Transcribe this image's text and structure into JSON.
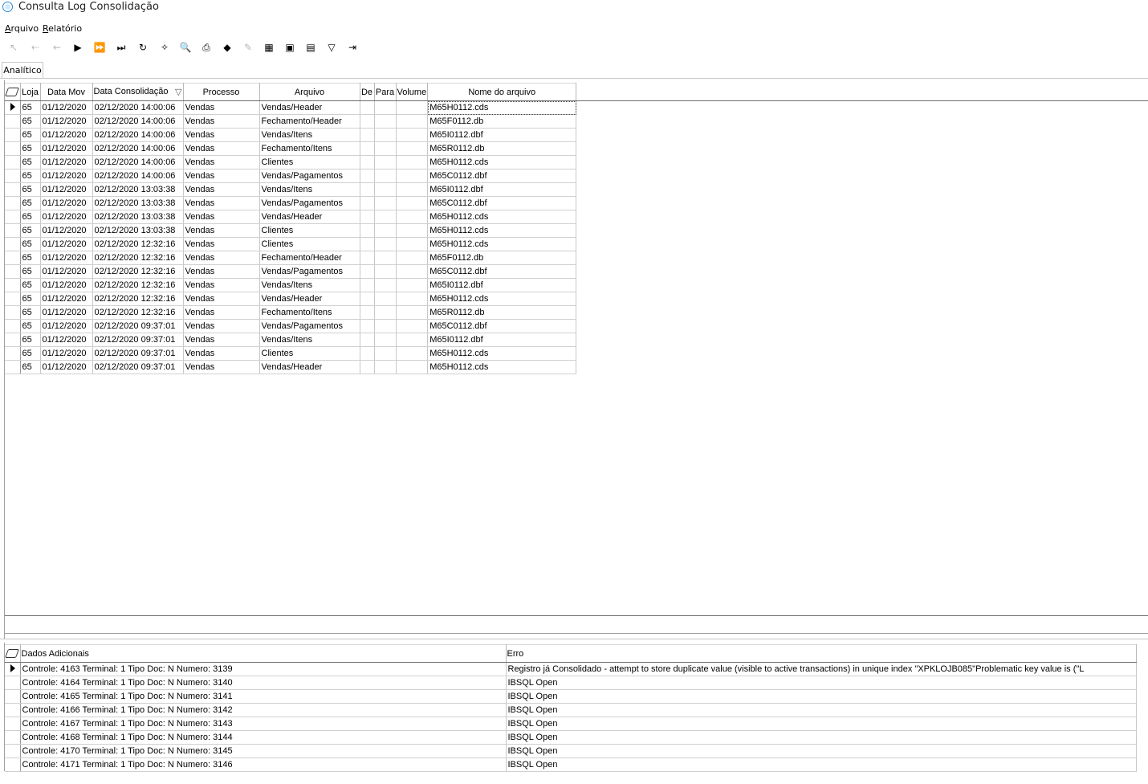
{
  "window": {
    "title": "Consulta Log Consolidação"
  },
  "menu": [
    {
      "label": "Arquivo",
      "underline": "A",
      "rest": "rquivo"
    },
    {
      "label": "Relatório",
      "underline": "R",
      "rest": "elatório"
    }
  ],
  "toolbar": [
    {
      "name": "first-record-icon",
      "glyph": "↖",
      "disabled": true
    },
    {
      "name": "prior-page-icon",
      "glyph": "⇠",
      "disabled": true
    },
    {
      "name": "prior-record-icon",
      "glyph": "←",
      "disabled": true
    },
    {
      "name": "next-record-icon",
      "glyph": "▶",
      "disabled": false
    },
    {
      "name": "next-page-icon",
      "glyph": "⏩",
      "disabled": false
    },
    {
      "name": "last-record-icon",
      "glyph": "⏭",
      "disabled": false
    },
    {
      "name": "refresh-icon",
      "glyph": "↻",
      "disabled": false
    },
    {
      "name": "wand-icon",
      "glyph": "✧",
      "disabled": false
    },
    {
      "name": "preview-icon",
      "glyph": "🔍",
      "disabled": false
    },
    {
      "name": "print-icon",
      "glyph": "⎙",
      "disabled": false
    },
    {
      "name": "tag-icon",
      "glyph": "◆",
      "disabled": false
    },
    {
      "name": "goto-icon",
      "glyph": "✎",
      "disabled": true
    },
    {
      "name": "filter-image-icon",
      "glyph": "▦",
      "disabled": false
    },
    {
      "name": "export-icon",
      "glyph": "▣",
      "disabled": false
    },
    {
      "name": "grid-export-icon",
      "glyph": "▤",
      "disabled": false
    },
    {
      "name": "funnel-icon",
      "glyph": "▽",
      "disabled": false
    },
    {
      "name": "exit-icon",
      "glyph": "⇥",
      "disabled": false
    }
  ],
  "tabs": [
    {
      "label": "Analítico"
    }
  ],
  "main_grid": {
    "columns": [
      "Loja",
      "Data Mov",
      "Data Consolidação",
      "Processo",
      "Arquivo",
      "De",
      "Para",
      "Volume",
      "Nome do arquivo"
    ],
    "sort_indicator": "▽",
    "rows": [
      [
        "65",
        "01/12/2020",
        "02/12/2020 14:00:06",
        "Vendas",
        "Vendas/Header",
        "",
        "",
        "",
        "M65H0112.cds"
      ],
      [
        "65",
        "01/12/2020",
        "02/12/2020 14:00:06",
        "Vendas",
        "Fechamento/Header",
        "",
        "",
        "",
        "M65F0112.db"
      ],
      [
        "65",
        "01/12/2020",
        "02/12/2020 14:00:06",
        "Vendas",
        "Vendas/Itens",
        "",
        "",
        "",
        "M65I0112.dbf"
      ],
      [
        "65",
        "01/12/2020",
        "02/12/2020 14:00:06",
        "Vendas",
        "Fechamento/Itens",
        "",
        "",
        "",
        "M65R0112.db"
      ],
      [
        "65",
        "01/12/2020",
        "02/12/2020 14:00:06",
        "Vendas",
        "Clientes",
        "",
        "",
        "",
        "M65H0112.cds"
      ],
      [
        "65",
        "01/12/2020",
        "02/12/2020 14:00:06",
        "Vendas",
        "Vendas/Pagamentos",
        "",
        "",
        "",
        "M65C0112.dbf"
      ],
      [
        "65",
        "01/12/2020",
        "02/12/2020 13:03:38",
        "Vendas",
        "Vendas/Itens",
        "",
        "",
        "",
        "M65I0112.dbf"
      ],
      [
        "65",
        "01/12/2020",
        "02/12/2020 13:03:38",
        "Vendas",
        "Vendas/Pagamentos",
        "",
        "",
        "",
        "M65C0112.dbf"
      ],
      [
        "65",
        "01/12/2020",
        "02/12/2020 13:03:38",
        "Vendas",
        "Vendas/Header",
        "",
        "",
        "",
        "M65H0112.cds"
      ],
      [
        "65",
        "01/12/2020",
        "02/12/2020 13:03:38",
        "Vendas",
        "Clientes",
        "",
        "",
        "",
        "M65H0112.cds"
      ],
      [
        "65",
        "01/12/2020",
        "02/12/2020 12:32:16",
        "Vendas",
        "Clientes",
        "",
        "",
        "",
        "M65H0112.cds"
      ],
      [
        "65",
        "01/12/2020",
        "02/12/2020 12:32:16",
        "Vendas",
        "Fechamento/Header",
        "",
        "",
        "",
        "M65F0112.db"
      ],
      [
        "65",
        "01/12/2020",
        "02/12/2020 12:32:16",
        "Vendas",
        "Vendas/Pagamentos",
        "",
        "",
        "",
        "M65C0112.dbf"
      ],
      [
        "65",
        "01/12/2020",
        "02/12/2020 12:32:16",
        "Vendas",
        "Vendas/Itens",
        "",
        "",
        "",
        "M65I0112.dbf"
      ],
      [
        "65",
        "01/12/2020",
        "02/12/2020 12:32:16",
        "Vendas",
        "Vendas/Header",
        "",
        "",
        "",
        "M65H0112.cds"
      ],
      [
        "65",
        "01/12/2020",
        "02/12/2020 12:32:16",
        "Vendas",
        "Fechamento/Itens",
        "",
        "",
        "",
        "M65R0112.db"
      ],
      [
        "65",
        "01/12/2020",
        "02/12/2020 09:37:01",
        "Vendas",
        "Vendas/Pagamentos",
        "",
        "",
        "",
        "M65C0112.dbf"
      ],
      [
        "65",
        "01/12/2020",
        "02/12/2020 09:37:01",
        "Vendas",
        "Vendas/Itens",
        "",
        "",
        "",
        "M65I0112.dbf"
      ],
      [
        "65",
        "01/12/2020",
        "02/12/2020 09:37:01",
        "Vendas",
        "Clientes",
        "",
        "",
        "",
        "M65H0112.cds"
      ],
      [
        "65",
        "01/12/2020",
        "02/12/2020 09:37:01",
        "Vendas",
        "Vendas/Header",
        "",
        "",
        "",
        "M65H0112.cds"
      ]
    ]
  },
  "detail_grid": {
    "columns": [
      "Dados Adicionais",
      "Erro"
    ],
    "rows": [
      [
        "Controle: 4163 Terminal: 1 Tipo Doc: N Numero: 3139",
        "Registro já Consolidado - attempt to store duplicate value (visible to active transactions) in unique index \"XPKLOJB085\"Problematic key value is (\"L"
      ],
      [
        "Controle: 4164 Terminal: 1 Tipo Doc: N Numero: 3140",
        "IBSQL Open"
      ],
      [
        "Controle: 4165 Terminal: 1 Tipo Doc: N Numero: 3141",
        "IBSQL Open"
      ],
      [
        "Controle: 4166 Terminal: 1 Tipo Doc: N Numero: 3142",
        "IBSQL Open"
      ],
      [
        "Controle: 4167 Terminal: 1 Tipo Doc: N Numero: 3143",
        "IBSQL Open"
      ],
      [
        "Controle: 4168 Terminal: 1 Tipo Doc: N Numero: 3144",
        "IBSQL Open"
      ],
      [
        "Controle: 4170 Terminal: 1 Tipo Doc: N Numero: 3145",
        "IBSQL Open"
      ],
      [
        "Controle: 4171 Terminal: 1 Tipo Doc: N Numero: 3146",
        "IBSQL Open"
      ]
    ]
  }
}
